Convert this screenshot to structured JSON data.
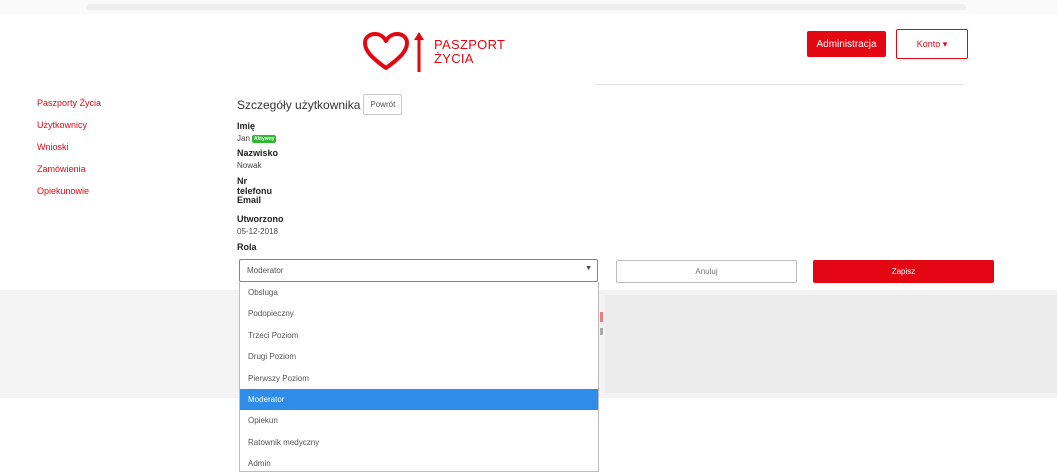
{
  "header": {
    "brand_line1": "PASZPORT",
    "brand_line2": "ŻYCIA",
    "admin_label": "Administracja",
    "account_label": "Konto ▾"
  },
  "sidebar": {
    "items": [
      {
        "label": "Paszporty Życia"
      },
      {
        "label": "Użytkownicy"
      },
      {
        "label": "Wnioski"
      },
      {
        "label": "Zamówienia"
      },
      {
        "label": "Opiekunowie"
      }
    ]
  },
  "details": {
    "title": "Szczegóły użytkownika",
    "back_label": "Powrót",
    "fields": {
      "first_name_label": "Imię",
      "first_name": "Jan",
      "status_badge": "Aktywny",
      "last_name_label": "Nazwisko",
      "last_name": "Nowak",
      "phone_label": "Nr telefonu",
      "email_label": "Email",
      "created_label": "Utworzono",
      "created": "05-12-2018",
      "role_label": "Rola"
    }
  },
  "role_select": {
    "value": "Moderator",
    "options": [
      "Obsluga",
      "Podopieczny",
      "Trzeci Poziom",
      "Drugi Poziom",
      "Pierwszy Poziom",
      "Moderator",
      "Opiekun",
      "Ratownik medyczny",
      "Admin"
    ],
    "selected_index": 5
  },
  "actions": {
    "cancel_label": "Anuluj",
    "save_label": "Zapisz"
  },
  "colors": {
    "brand": "#e30613",
    "status_active": "#2eb82e",
    "option_highlight": "#2f8ce8"
  },
  "icons": {
    "logo": "heart-arrow-logo",
    "caret": "caret-down-icon"
  }
}
